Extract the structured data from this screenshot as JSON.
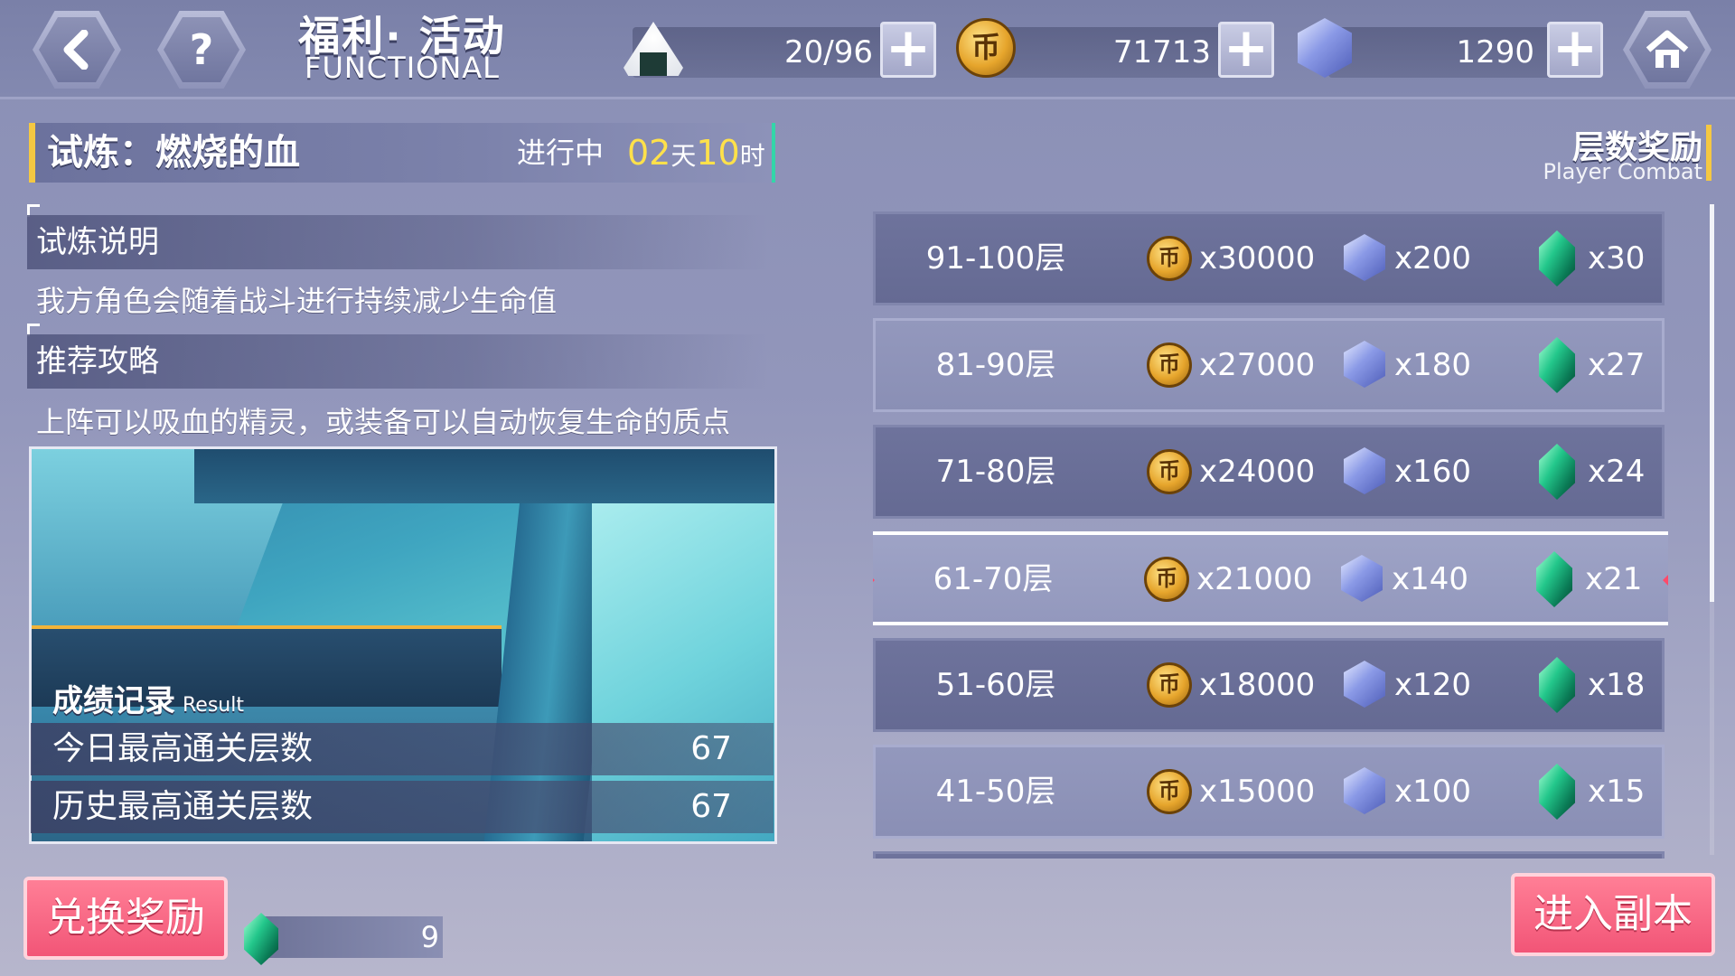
{
  "header": {
    "title": "福利· 活动",
    "subtitle": "FUNCTIONAL",
    "back_icon": "back-chevron-icon",
    "help_icon": "question-icon",
    "home_icon": "home-icon",
    "stamina": "20/96",
    "gold": "71713",
    "crystal": "1290",
    "coin_glyph": "币"
  },
  "trial": {
    "title": "试炼：燃烧的血",
    "status": "进行中",
    "time_days": "02",
    "time_days_unit": "天",
    "time_hours": "10",
    "time_hours_unit": "时"
  },
  "sections": {
    "desc_title": "试炼说明",
    "desc_text": "我方角色会随着战斗进行持续减少生命值",
    "tips_title": "推荐攻略",
    "tips_text": "上阵可以吸血的精灵，或装备可以自动恢复生命的质点"
  },
  "result": {
    "title": "成绩记录",
    "title_en": "Result",
    "today_label": "今日最高通关层数",
    "today_value": "67",
    "history_label": "历史最高通关层数",
    "history_value": "67"
  },
  "rewards": {
    "title": "层数奖励",
    "title_en": "Player Combat",
    "rows": [
      {
        "floor": "91-100层",
        "gold": "x30000",
        "crystal": "x200",
        "gem": "x30"
      },
      {
        "floor": "81-90层",
        "gold": "x27000",
        "crystal": "x180",
        "gem": "x27"
      },
      {
        "floor": "71-80层",
        "gold": "x24000",
        "crystal": "x160",
        "gem": "x24"
      },
      {
        "floor": "61-70层",
        "gold": "x21000",
        "crystal": "x140",
        "gem": "x21"
      },
      {
        "floor": "51-60层",
        "gold": "x18000",
        "crystal": "x120",
        "gem": "x18"
      },
      {
        "floor": "41-50层",
        "gold": "x15000",
        "crystal": "x100",
        "gem": "x15"
      }
    ]
  },
  "bottom": {
    "exchange_label": "兑换奖励",
    "gem_count": "9",
    "enter_label": "进入副本"
  },
  "colors": {
    "accent_yellow": "#ffe14a",
    "button_red": "#f25577",
    "gem_green": "#23c78b"
  }
}
